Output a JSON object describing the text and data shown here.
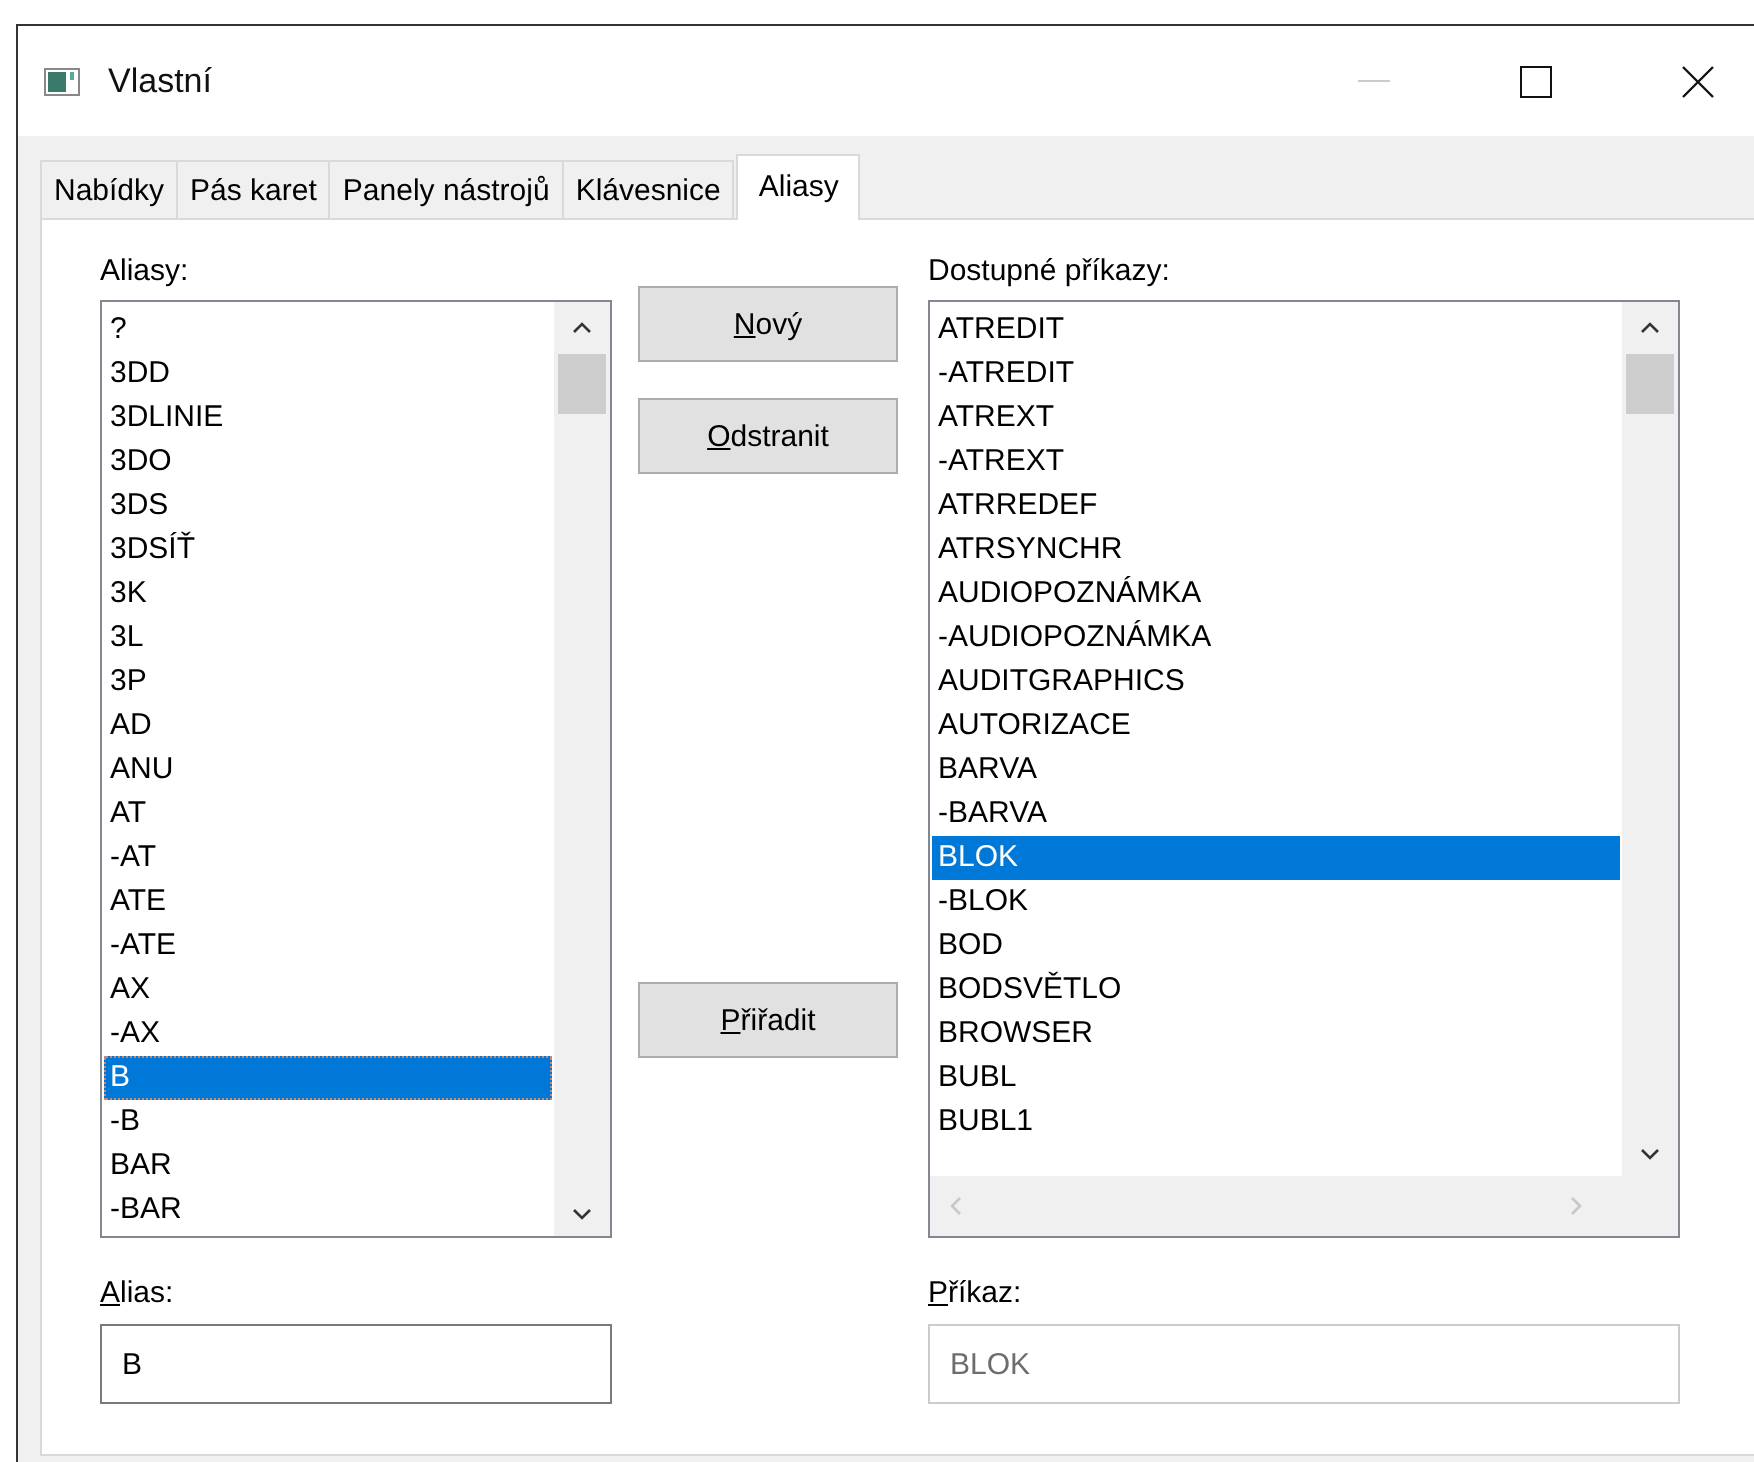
{
  "window": {
    "title": "Vlastní"
  },
  "tabs": [
    {
      "label": "Nabídky",
      "selected": false
    },
    {
      "label": "Pás karet",
      "selected": false
    },
    {
      "label": "Panely nástrojů",
      "selected": false
    },
    {
      "label": "Klávesnice",
      "selected": false
    },
    {
      "label": "Aliasy",
      "selected": true
    }
  ],
  "aliases": {
    "label": "Aliasy:",
    "items": [
      {
        "text": "?",
        "selected": false
      },
      {
        "text": "3DD",
        "selected": false
      },
      {
        "text": "3DLINIE",
        "selected": false
      },
      {
        "text": "3DO",
        "selected": false
      },
      {
        "text": "3DS",
        "selected": false
      },
      {
        "text": "3DSÍŤ",
        "selected": false
      },
      {
        "text": "3K",
        "selected": false
      },
      {
        "text": "3L",
        "selected": false
      },
      {
        "text": "3P",
        "selected": false
      },
      {
        "text": "AD",
        "selected": false
      },
      {
        "text": "ANU",
        "selected": false
      },
      {
        "text": "AT",
        "selected": false
      },
      {
        "text": "-AT",
        "selected": false
      },
      {
        "text": "ATE",
        "selected": false
      },
      {
        "text": "-ATE",
        "selected": false
      },
      {
        "text": "AX",
        "selected": false
      },
      {
        "text": "-AX",
        "selected": false
      },
      {
        "text": "B",
        "selected": true
      },
      {
        "text": "-B",
        "selected": false
      },
      {
        "text": "BAR",
        "selected": false
      },
      {
        "text": "-BAR",
        "selected": false
      }
    ]
  },
  "buttons": [
    {
      "label": "Nový"
    },
    {
      "label": "Odstranit"
    },
    {
      "label": "Přiřadit"
    }
  ],
  "commands": {
    "label": "Dostupné příkazy:",
    "items": [
      {
        "text": "ATREDIT",
        "selected": false
      },
      {
        "text": "-ATREDIT",
        "selected": false
      },
      {
        "text": "ATREXT",
        "selected": false
      },
      {
        "text": "-ATREXT",
        "selected": false
      },
      {
        "text": "ATRREDEF",
        "selected": false
      },
      {
        "text": "ATRSYNCHR",
        "selected": false
      },
      {
        "text": "AUDIOPOZNÁMKA",
        "selected": false
      },
      {
        "text": "-AUDIOPOZNÁMKA",
        "selected": false
      },
      {
        "text": "AUDITGRAPHICS",
        "selected": false
      },
      {
        "text": "AUTORIZACE",
        "selected": false
      },
      {
        "text": "BARVA",
        "selected": false
      },
      {
        "text": "-BARVA",
        "selected": false
      },
      {
        "text": "BLOK",
        "selected": true
      },
      {
        "text": "-BLOK",
        "selected": false
      },
      {
        "text": "BOD",
        "selected": false
      },
      {
        "text": "BODSVĚTLO",
        "selected": false
      },
      {
        "text": "BROWSER",
        "selected": false
      },
      {
        "text": "BUBL",
        "selected": false
      },
      {
        "text": "BUBL1",
        "selected": false
      }
    ]
  },
  "alias_field": {
    "label": "Alias:",
    "value": "B",
    "disabled": false
  },
  "command_field": {
    "label": "Příkaz:",
    "value": "BLOK",
    "disabled": true
  }
}
